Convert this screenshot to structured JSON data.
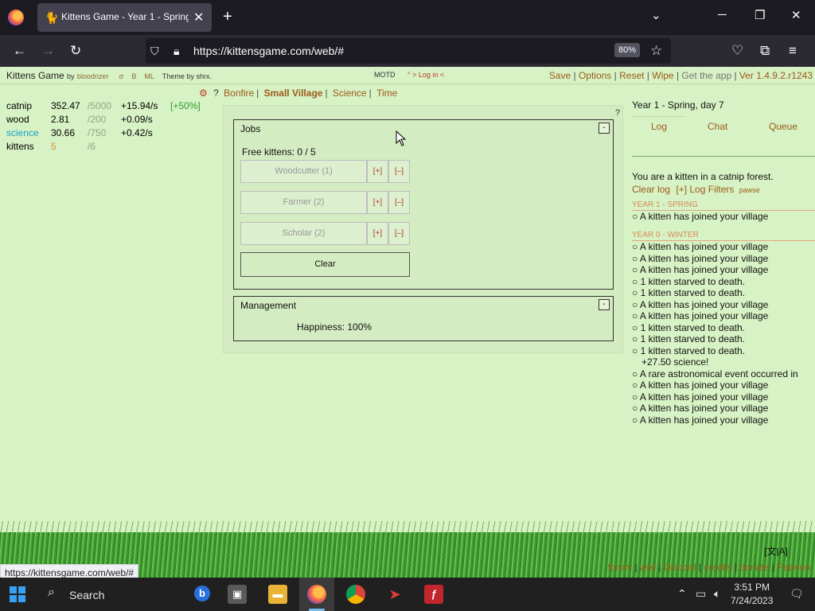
{
  "browser": {
    "tab_title": "Kittens Game - Year 1 - Spring,",
    "new_tab": "+",
    "close": "✕",
    "url": "https://kittensgame.com/web/#",
    "zoom": "80%",
    "status_url": "https://kittensgame.com/web/#"
  },
  "game": {
    "title": "Kittens Game",
    "by": "by",
    "author": "bloodrizer",
    "sigma": "σ",
    "b": "B",
    "ml": "ML",
    "theme": "Theme by shrx.",
    "motd": "MOTD",
    "login": "° > Log in <",
    "top_links": [
      "Save",
      "Options",
      "Reset",
      "Wipe",
      "Get the app",
      "Ver 1.4.9.2.r1243"
    ]
  },
  "resources": [
    {
      "name": "catnip",
      "value": "352.47",
      "max": "/5000",
      "rate": "+15.94/s",
      "bonus": "[+50%]",
      "color": "#111"
    },
    {
      "name": "wood",
      "value": "2.81",
      "max": "/200",
      "rate": "+0.09/s",
      "bonus": "",
      "color": "#111"
    },
    {
      "name": "science",
      "value": "30.66",
      "max": "/750",
      "rate": "+0.42/s",
      "bonus": "",
      "color": "#1aa0c8"
    },
    {
      "name": "kittens",
      "value": "5",
      "max": "/6",
      "rate": "",
      "bonus": "",
      "color": "#111"
    }
  ],
  "nav": {
    "gear": "⚙",
    "help": "?",
    "tabs": [
      "Bonfire",
      "Small Village",
      "Science",
      "Time"
    ]
  },
  "jobs": {
    "title": "Jobs",
    "collapse": "-",
    "free_kittens": "Free kittens: 0 / 5",
    "list": [
      {
        "label": "Woodcutter (1)",
        "plus": "[+]",
        "minus": "[–]"
      },
      {
        "label": "Farmer (2)",
        "plus": "[+]",
        "minus": "[–]"
      },
      {
        "label": "Scholar (2)",
        "plus": "[+]",
        "minus": "[–]"
      }
    ],
    "clear": "Clear"
  },
  "management": {
    "title": "Management",
    "collapse": "-",
    "happiness": "Happiness: 100%"
  },
  "panel_help": "?",
  "sidebar": {
    "date": "Year 1 - Spring, day 7",
    "tabs": [
      "Log",
      "Chat",
      "Queue"
    ],
    "intro": "You are a kitten in a catnip forest.",
    "clear_log": "Clear log",
    "log_filters": "[+] Log Filters",
    "pawse": "pawse",
    "sections": [
      {
        "header": "YEAR 1 - SPRING",
        "entries": [
          "A kitten has joined your village"
        ]
      },
      {
        "header": "YEAR 0 - WINTER",
        "entries": [
          "A kitten has joined your village",
          "A kitten has joined your village",
          "A kitten has joined your village",
          "1 kitten starved to death.",
          "1 kitten starved to death.",
          "A kitten has joined your village",
          "A kitten has joined your village",
          "1 kitten starved to death.",
          "1 kitten starved to death.",
          "1 kitten starved to death.",
          "+27.50 science!",
          "A rare astronomical event occurred in",
          "A kitten has joined your village",
          "A kitten has joined your village",
          "A kitten has joined your village",
          "A kitten has joined your village"
        ]
      }
    ]
  },
  "footer": {
    "lang": "[文|A]",
    "links": [
      "forum",
      "wiki",
      "Discord",
      "credits",
      "donate",
      "Patreon"
    ]
  },
  "taskbar": {
    "search": "Search",
    "time": "3:51 PM",
    "date": "7/24/2023"
  },
  "colors": {
    "page_bg": "#d7f2c4",
    "link": "#9c5a1a",
    "science": "#1aa0c8",
    "kittens_value": "#e08a3c",
    "bonus": "#2e9a2e",
    "minus_plus": "#b23b2b"
  }
}
